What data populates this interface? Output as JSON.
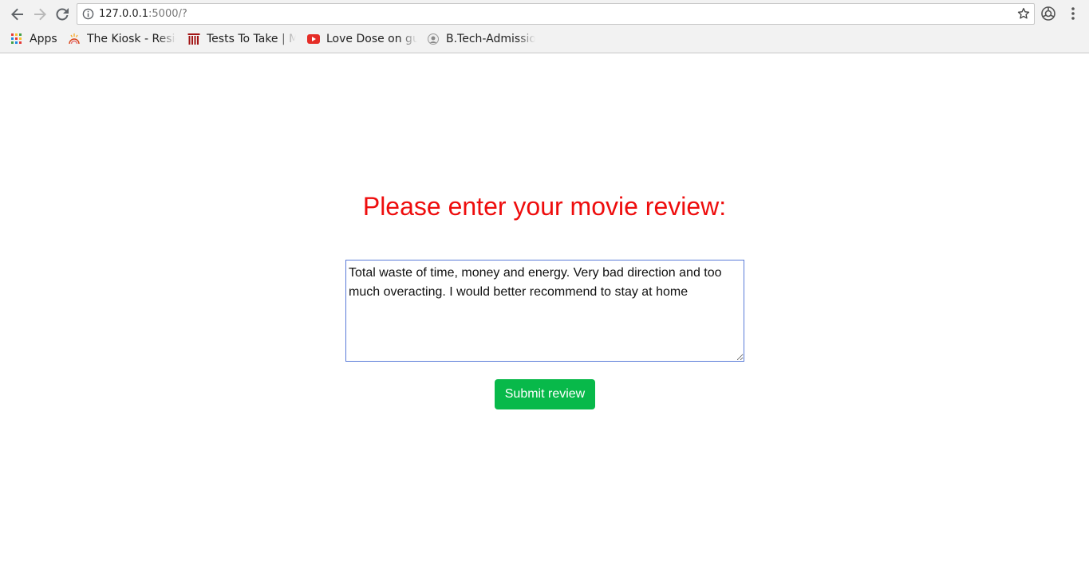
{
  "browser": {
    "url_host": "127.0.0.1",
    "url_path": ":5000/?",
    "bookmarks": [
      {
        "label": "Apps",
        "icon": "apps-grid-icon"
      },
      {
        "label": "The Kiosk - Resid",
        "icon": "kiosk-icon"
      },
      {
        "label": "Tests To Take | M",
        "icon": "tests-icon"
      },
      {
        "label": "Love Dose on gu",
        "icon": "youtube-icon"
      },
      {
        "label": "B.Tech-Admissio",
        "icon": "admission-icon"
      }
    ]
  },
  "page": {
    "heading": "Please enter your movie review:",
    "review_text": "Total waste of time, money and energy. Very bad direction and too much overacting. I would better recommend to stay at home",
    "submit_label": "Submit review"
  },
  "colors": {
    "heading": "#ee0d0d",
    "submit_bg": "#08b94a",
    "textarea_border": "#5a7bd8"
  }
}
